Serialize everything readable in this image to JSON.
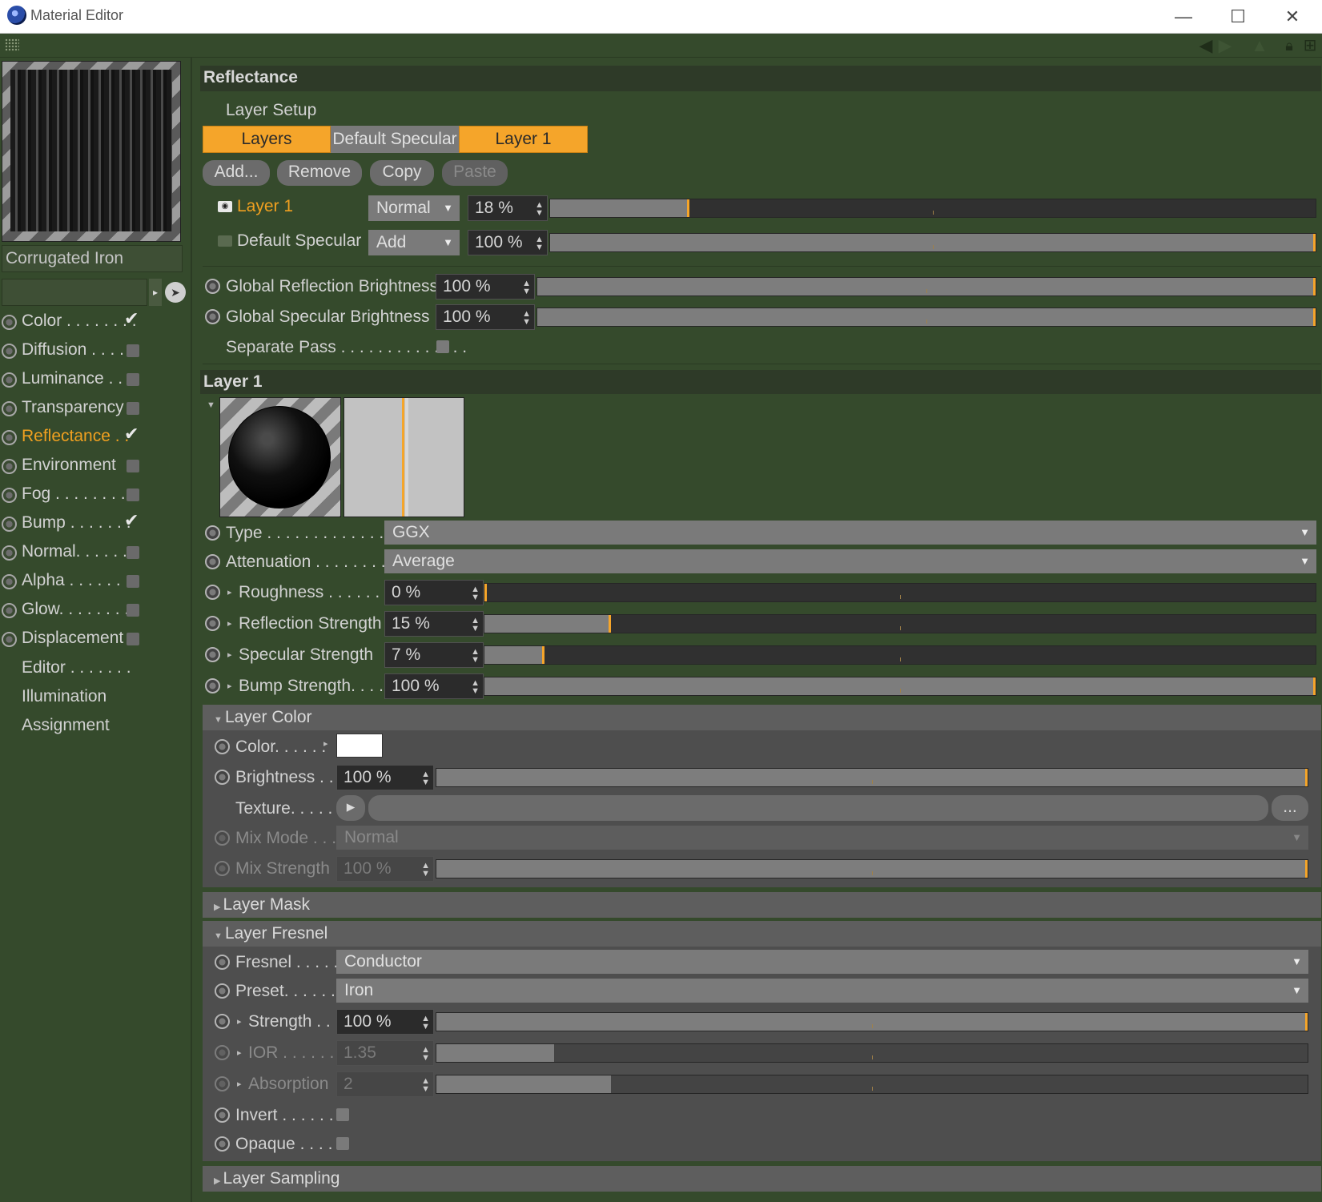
{
  "window": {
    "title": "Material Editor",
    "minimize": "—",
    "maximize": "☐",
    "close": "✕"
  },
  "toolbar": {
    "icons": [
      "back-arrow-icon",
      "forward-arrow-icon",
      "up-arrow-icon",
      "lock-icon",
      "new-window-icon"
    ]
  },
  "material": {
    "name": "Corrugated Iron"
  },
  "channels": [
    {
      "label": "Color . . . . . . . .",
      "checked": true
    },
    {
      "label": "Diffusion . . . .",
      "checked": false
    },
    {
      "label": "Luminance . .",
      "checked": false
    },
    {
      "label": "Transparency",
      "checked": false
    },
    {
      "label": "Reflectance . .",
      "checked": true,
      "active": true
    },
    {
      "label": "Environment",
      "checked": false
    },
    {
      "label": "Fog . . . . . . . . .",
      "checked": false
    },
    {
      "label": "Bump . . . . . . .",
      "checked": true
    },
    {
      "label": "Normal. . . . . .",
      "checked": false
    },
    {
      "label": "Alpha . . . . . . .",
      "checked": false
    },
    {
      "label": "Glow. . . . . . . .",
      "checked": false
    },
    {
      "label": "Displacement",
      "checked": false
    }
  ],
  "nav": [
    "Editor . . . . . . .",
    "Illumination",
    "Assignment"
  ],
  "reflectance": {
    "header": "Reflectance",
    "layer_setup": "Layer Setup",
    "tabs": [
      "Layers",
      "Default Specular",
      "Layer 1"
    ],
    "buttons": {
      "add": "Add...",
      "remove": "Remove",
      "copy": "Copy",
      "paste": "Paste"
    },
    "layers": [
      {
        "name": "Layer 1",
        "mode": "Normal",
        "value": "18 %",
        "fraction": 0.18
      },
      {
        "name": "Default Specular",
        "mode": "Add",
        "value": "100 %",
        "fraction": 1.0
      }
    ],
    "global_reflection": {
      "label": "Global Reflection Brightness",
      "value": "100 %"
    },
    "global_specular": {
      "label": "Global Specular Brightness",
      "value": "100 %"
    },
    "separate_pass": "Separate Pass . . . . . . . . . . . . . ."
  },
  "layer1": {
    "header": "Layer 1",
    "type": {
      "label": "Type . . . . . . . . . . . . . . . .",
      "value": "GGX"
    },
    "attenuation": {
      "label": "Attenuation . . . . . . . . .",
      "value": "Average"
    },
    "roughness": {
      "label": "Roughness . . . . . . . .",
      "value": "0 %",
      "fraction": 0.0
    },
    "reflection_strength": {
      "label": "Reflection Strength",
      "value": "15 %",
      "fraction": 0.15
    },
    "specular_strength": {
      "label": "Specular Strength",
      "value": "7 %",
      "fraction": 0.07
    },
    "bump_strength": {
      "label": "Bump Strength. . . .",
      "value": "100 %",
      "fraction": 1.0
    }
  },
  "layer_color": {
    "header": "Layer Color",
    "color": {
      "label": "Color. . . . . .",
      "swatch": "#ffffff"
    },
    "brightness": {
      "label": "Brightness . .",
      "value": "100 %"
    },
    "texture": {
      "label": "Texture. . . . . .",
      "more": "..."
    },
    "mix_mode": {
      "label": "Mix Mode . . .",
      "value": "Normal"
    },
    "mix_strength": {
      "label": "Mix Strength",
      "value": "100 %"
    }
  },
  "layer_mask": {
    "header": "Layer Mask"
  },
  "layer_fresnel": {
    "header": "Layer Fresnel",
    "fresnel": {
      "label": "Fresnel . . . . . .",
      "value": "Conductor"
    },
    "preset": {
      "label": "Preset. . . . . . .",
      "value": "Iron"
    },
    "strength": {
      "label": "Strength . .",
      "value": "100 %"
    },
    "ior": {
      "label": "IOR . . . . . . .",
      "value": "1.35",
      "fraction": 0.135
    },
    "absorption": {
      "label": "Absorption",
      "value": "2",
      "fraction": 0.2
    },
    "invert": {
      "label": "Invert . . . . . . ."
    },
    "opaque": {
      "label": "Opaque . . . . ."
    }
  },
  "layer_sampling": {
    "header": "Layer Sampling"
  },
  "colors": {
    "accent": "#f5a52a",
    "panel_bg": "#354a2c",
    "sub_bg": "#4e4e4e"
  }
}
